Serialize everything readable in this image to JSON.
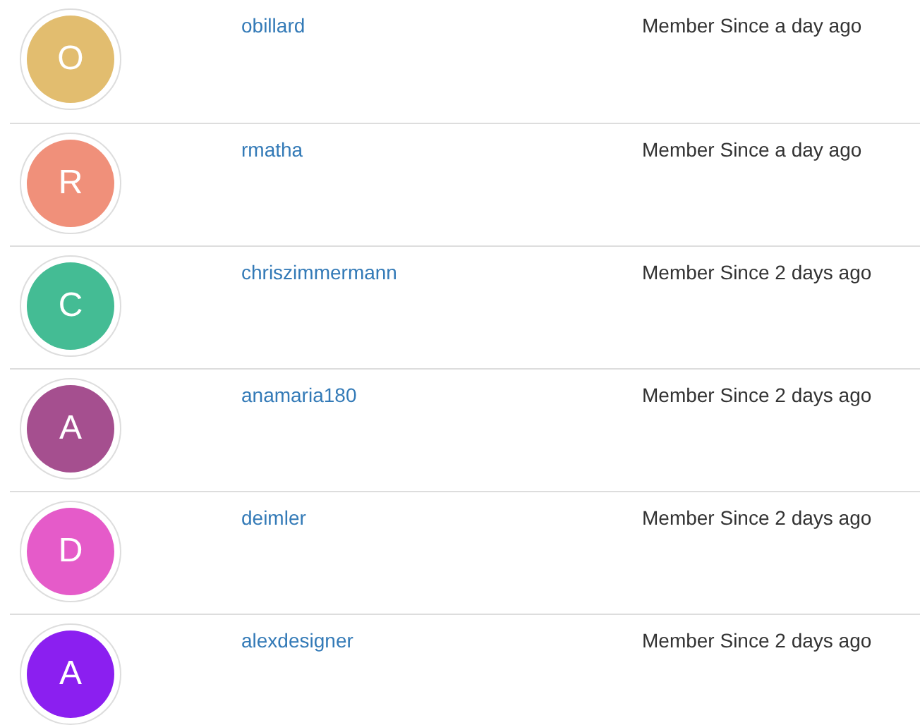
{
  "members": [
    {
      "initial": "O",
      "color": "#e2bd6f",
      "username": "obillard",
      "member_since": "Member Since a day ago"
    },
    {
      "initial": "R",
      "color": "#f0907a",
      "username": "rmatha",
      "member_since": "Member Since a day ago"
    },
    {
      "initial": "C",
      "color": "#44bc94",
      "username": "chriszimmermann",
      "member_since": "Member Since 2 days ago"
    },
    {
      "initial": "A",
      "color": "#a54f8f",
      "username": "anamaria180",
      "member_since": "Member Since 2 days ago"
    },
    {
      "initial": "D",
      "color": "#e55bc9",
      "username": "deimler",
      "member_since": "Member Since 2 days ago"
    },
    {
      "initial": "A",
      "color": "#8b1ff0",
      "username": "alexdesigner",
      "member_since": "Member Since 2 days ago"
    }
  ]
}
